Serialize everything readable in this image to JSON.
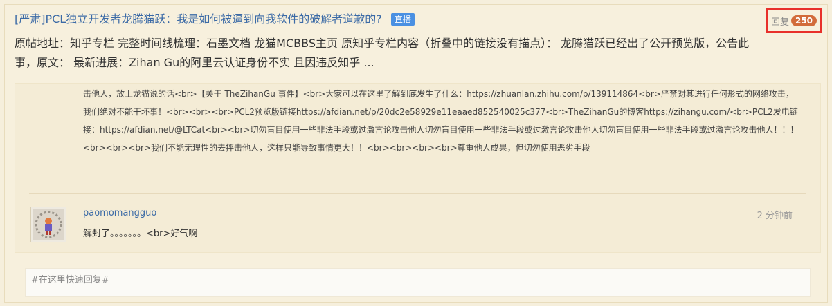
{
  "post": {
    "title": "[严肃]PCL独立开发者龙腾猫跃：我是如何被逼到向我软件的破解者道歉的?",
    "tag": "直播",
    "reply_label": "回复",
    "reply_count": "250",
    "summary": "原帖地址：知乎专栏 完整时间线梳理：石墨文档 龙猫MCBBS主页 原知乎专栏内容（折叠中的链接没有描点）： 龙腾猫跃已经出了公开预览版，公告此事，原文： 最新进展：Zihan Gu的阿里云认证身份不实 且因违反知乎 ..."
  },
  "thread": {
    "body_text": "击他人，放上龙猫说的话<br>【关于 TheZihanGu 事件】<br>大家可以在这里了解到底发生了什么：https://zhuanlan.zhihu.com/p/139114864<br>严禁对其进行任何形式的网络攻击，我们绝对不能干坏事！<br><br><br>PCL2预览版链接https://afdian.net/p/20dc2e58929e11eaaed852540025c377<br>TheZihanGu的博客https://zihangu.com/<br>PCL2发电链接：https://afdian.net/@LTCat<br><br>切勿盲目使用一些非法手段或过激言论攻击他人切勿盲目使用一些非法手段或过激言论攻击他人切勿盲目使用一些非法手段或过激言论攻击他人！！！<br><br><br>我们不能无理性的去抨击他人，这样只能导致事情更大！！<br><br><br><br>尊重他人成果，但切勿使用恶劣手段",
    "comment": {
      "username": "paomomangguo",
      "time": "2 分钟前",
      "text": "解封了。。。。。。。<br>好气啊"
    }
  },
  "quick_reply": {
    "placeholder": "#在这里快速回复#"
  }
}
